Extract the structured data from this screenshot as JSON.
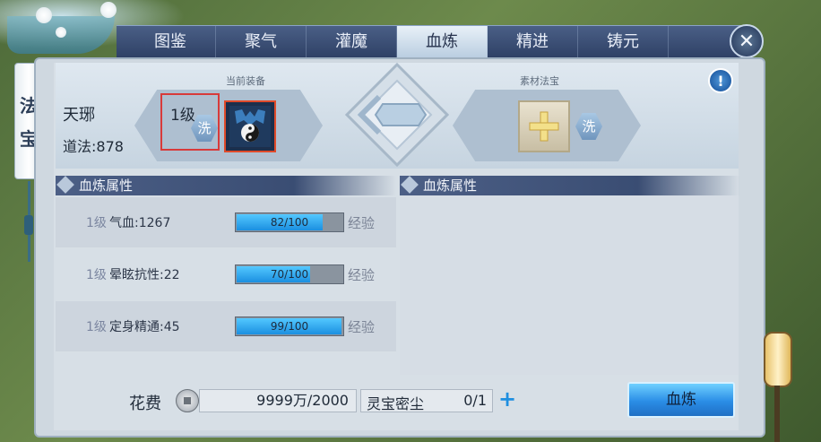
{
  "tabs": [
    "图鉴",
    "聚气",
    "灌魔",
    "血炼",
    "精进",
    "铸元"
  ],
  "active_tab_index": 3,
  "side_tab": {
    "chars": [
      "法",
      "宝"
    ]
  },
  "equip": {
    "current_caption": "当前装备",
    "material_caption": "素材法宝",
    "name": "天琊",
    "dao_label": "道法:878",
    "level": "1级",
    "wash_label": "洗",
    "material_wash_label": "洗"
  },
  "sections": {
    "left_title": "血炼属性",
    "right_title": "血炼属性"
  },
  "attributes": [
    {
      "level": "1级",
      "name": "气血:1267",
      "progress_text": "82/100",
      "progress": 0.82,
      "exp_label": "经验"
    },
    {
      "level": "1级",
      "name": "晕眩抗性:22",
      "progress_text": "70/100",
      "progress": 0.7,
      "exp_label": "经验"
    },
    {
      "level": "1级",
      "name": "定身精通:45",
      "progress_text": "99/100",
      "progress": 0.99,
      "exp_label": "经验"
    }
  ],
  "footer": {
    "cost_label": "花费",
    "cost_value": "9999万/2000",
    "material_name": "灵宝密尘",
    "material_count": "0/1",
    "add_symbol": "+",
    "action_button": "血炼"
  },
  "icons": {
    "close": "close-icon",
    "info": "info-icon",
    "coin": "coin-icon",
    "add": "add-icon",
    "material_plus": "plus-icon",
    "equip": "equip-taiji-icon"
  },
  "colors": {
    "tab_active_bg": "#e8f1f8",
    "progress_fill": "#1b8fe0",
    "highlight_box": "#d83a3a",
    "action_button": "#2a8de6"
  }
}
